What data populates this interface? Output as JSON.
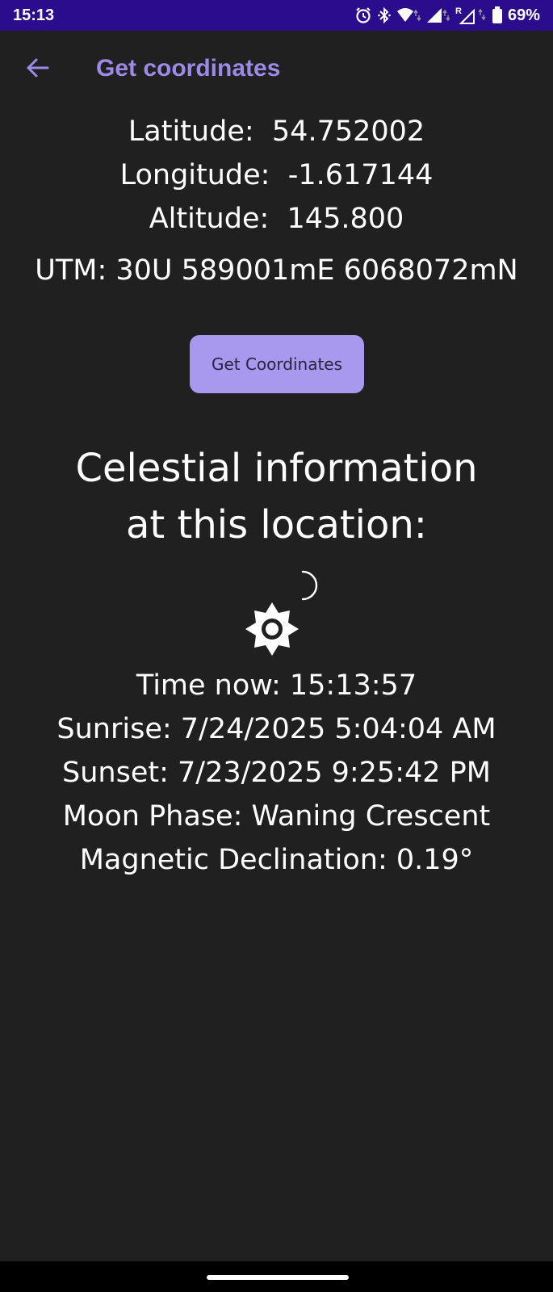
{
  "status_bar": {
    "time": "15:13",
    "battery_percent": "69%",
    "icons": [
      "alarm-icon",
      "bluetooth-icon",
      "wifi-icon",
      "signal-icon",
      "roaming-signal-icon",
      "battery-icon"
    ],
    "roaming_label": "R"
  },
  "app_bar": {
    "title": "Get coordinates",
    "back_icon": "arrow-left-icon",
    "accent_color": "#9d8ae6"
  },
  "coordinates": {
    "latitude": "Latitude:  54.752002",
    "longitude": "Longitude:  -1.617144",
    "altitude": "Altitude:  145.800",
    "utm": "UTM: 30U 589001mE 6068072mN"
  },
  "get_button": {
    "label": "Get Coordinates",
    "color": "#a898ee"
  },
  "celestial": {
    "heading_line1": "Celestial information",
    "heading_line2": "at this location:",
    "moon_icon": "crescent-moon-icon",
    "sun_icon": "sun-icon",
    "time_now": "Time now: 15:13:57",
    "sunrise": "Sunrise: 7/24/2025 5:04:04 AM",
    "sunset": "Sunset: 7/23/2025 9:25:42 PM",
    "moon_phase": "Moon Phase: Waning Crescent",
    "magnetic_declination": "Magnetic Declination: 0.19°"
  },
  "colors": {
    "status_bar_bg": "#2a0c8c",
    "background": "#202020"
  }
}
